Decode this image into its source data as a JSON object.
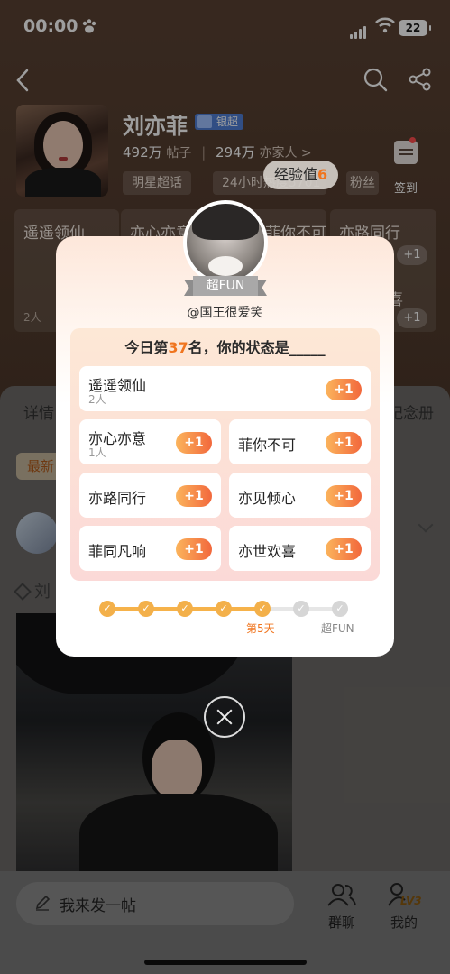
{
  "status_bar": {
    "time": "00:00",
    "battery": "22"
  },
  "profile": {
    "name": "刘亦菲",
    "level_badge": "银超",
    "posts_count": "492万",
    "posts_label": "帖子",
    "fans_count": "294万",
    "fans_label": "亦家人 >",
    "chips": [
      "明星超话",
      "24小时热度5701",
      "粉丝"
    ],
    "checkin_label": "签到",
    "exp_tooltip_label": "经验值",
    "exp_tooltip_value": "6"
  },
  "background_tags": [
    {
      "title": "遥遥领仙",
      "count": "2人",
      "plus": "+1"
    },
    {
      "title": "亦心亦意",
      "plus": "+1"
    },
    {
      "title": "菲你不可",
      "plus": "+1"
    },
    {
      "title": "亦路同行",
      "plus": "+1"
    },
    {
      "title": "喜",
      "plus": "+1"
    }
  ],
  "panel": {
    "tab_detail": "详情",
    "tab_memory": "纪念册",
    "chip_latest": "最新",
    "post_user_name": "刘"
  },
  "bottom_bar": {
    "compose_placeholder": "我来发一帖",
    "group_chat": "群聊",
    "mine": "我的",
    "mine_badge": "LV3"
  },
  "modal": {
    "ribbon": "超FUN",
    "username": "@国王很爱笑",
    "title_prefix": "今日第",
    "rank": "37",
    "title_suffix": "名，你的状态是_____",
    "options": [
      {
        "name": "遥遥领仙",
        "count": "2人",
        "plus": "+1"
      },
      {
        "name": "亦心亦意",
        "count": "1人",
        "plus": "+1"
      },
      {
        "name": "菲你不可",
        "plus": "+1"
      },
      {
        "name": "亦路同行",
        "plus": "+1"
      },
      {
        "name": "亦见倾心",
        "plus": "+1"
      },
      {
        "name": "菲同凡响",
        "plus": "+1"
      },
      {
        "name": "亦世欢喜",
        "plus": "+1"
      }
    ],
    "progress": {
      "current_day_label": "第5天",
      "goal_label": "超FUN",
      "completed_steps": 5,
      "total_steps": 7
    }
  },
  "colors": {
    "accent": "#f0751f",
    "plus_gradient_start": "#fbb45c",
    "plus_gradient_end": "#f2683c",
    "badge": "#4f7fd6"
  }
}
